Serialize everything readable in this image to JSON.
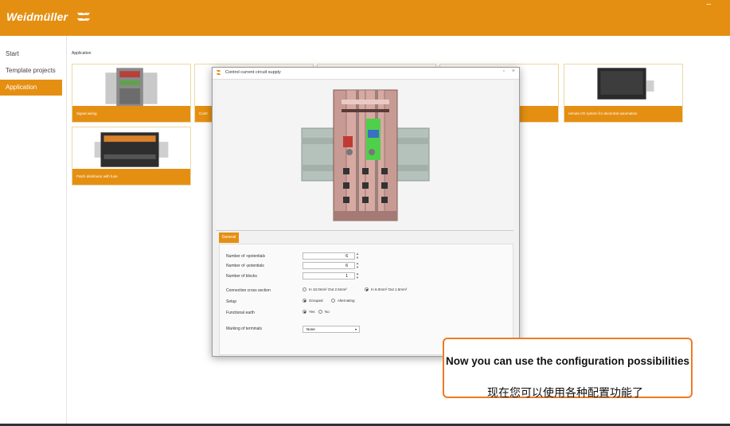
{
  "header": {
    "brand": "Weidmüller",
    "window_control": "–"
  },
  "sidebar": {
    "items": [
      {
        "label": "Start",
        "active": false
      },
      {
        "label": "Template projects",
        "active": false
      },
      {
        "label": "Application",
        "active": true
      }
    ]
  },
  "main": {
    "section_label": "Application",
    "cards": [
      {
        "label": "Signal wiring"
      },
      {
        "label": "Contr"
      },
      {
        "label": ""
      },
      {
        "label": ""
      },
      {
        "label": "remote I/O system for decentral automation"
      },
      {
        "label": "Patch distributor with fuse"
      }
    ]
  },
  "dialog": {
    "title": "Control current circuit supply",
    "tab": "General",
    "fields": {
      "plus_label": "Number of +potentials",
      "plus_value": "6",
      "minus_label": "Number of -potentials",
      "minus_value": "6",
      "blocks_label": "Number of blocks",
      "blocks_value": "1",
      "cross_label": "Connection cross section",
      "cross_opt1": "In 10.0mm²  Out  2.5mm²",
      "cross_opt2": "In  6.0mm²  Out  1.5mm²",
      "setup_label": "Setup",
      "setup_opt1": "Grouped",
      "setup_opt2": "Alternating",
      "earth_label": "Functional earth",
      "earth_opt1": "Yes",
      "earth_opt2": "No",
      "marking_label": "Marking of terminals",
      "marking_value": "None"
    }
  },
  "subtitle": {
    "english": "Now you can use the configuration possibilities",
    "chinese": "现在您可以使用各种配置功能了"
  },
  "colors": {
    "accent": "#e58f12",
    "subtitle_border": "#f07a22"
  }
}
